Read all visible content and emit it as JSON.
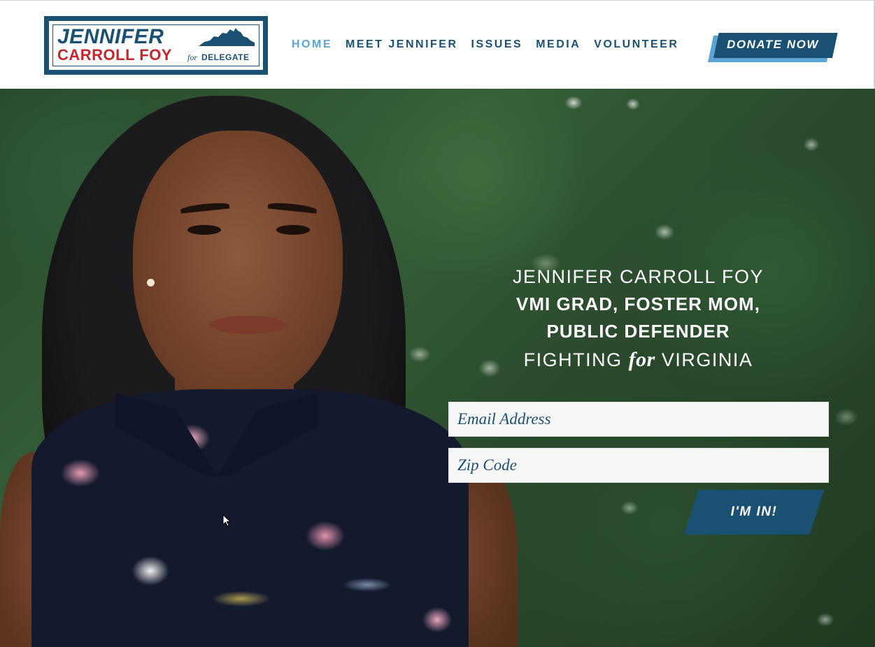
{
  "logo": {
    "line1": "JENNIFER",
    "line2": "CARROLL FOY",
    "for": "for",
    "delegate": "DELEGATE"
  },
  "nav": {
    "items": [
      {
        "label": "HOME",
        "active": true
      },
      {
        "label": "MEET JENNIFER",
        "active": false
      },
      {
        "label": "ISSUES",
        "active": false
      },
      {
        "label": "MEDIA",
        "active": false
      },
      {
        "label": "VOLUNTEER",
        "active": false
      }
    ],
    "donate_label": "DONATE NOW"
  },
  "hero": {
    "line1": "JENNIFER CARROLL FOY",
    "line2": "VMI GRAD, FOSTER MOM,",
    "line3": "PUBLIC DEFENDER",
    "line4_a": "FIGHTING",
    "line4_for": "for",
    "line4_b": "VIRGINIA"
  },
  "signup": {
    "email_placeholder": "Email Address",
    "zip_placeholder": "Zip Code",
    "submit_label": "I'M IN!"
  },
  "colors": {
    "navy": "#1a5173",
    "light_blue": "#5aa5d6",
    "red": "#c3262d"
  },
  "icons": {
    "state": "virginia-state-shape-icon",
    "cursor": "mouse-pointer-icon"
  }
}
